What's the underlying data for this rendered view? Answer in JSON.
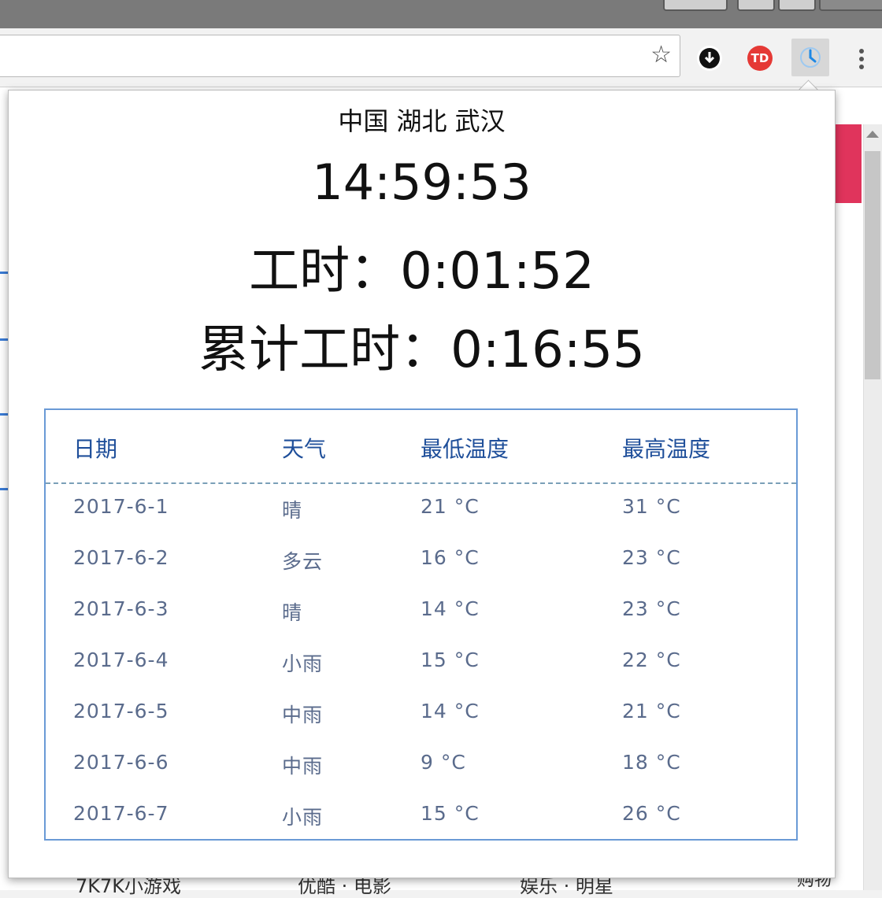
{
  "popup": {
    "location": "中国 湖北 武汉",
    "clock": "14:59:53",
    "work_time": "工时：0:01:52",
    "total_work_time": "累计工时：0:16:55"
  },
  "forecast": {
    "headers": [
      "日期",
      "天气",
      "最低温度",
      "最高温度"
    ],
    "rows": [
      {
        "date": "2017-6-1",
        "weather": "晴",
        "low": "21 °C",
        "high": "31 °C"
      },
      {
        "date": "2017-6-2",
        "weather": "多云",
        "low": "16 °C",
        "high": "23 °C"
      },
      {
        "date": "2017-6-3",
        "weather": "晴",
        "low": "14 °C",
        "high": "23 °C"
      },
      {
        "date": "2017-6-4",
        "weather": "小雨",
        "low": "15 °C",
        "high": "22 °C"
      },
      {
        "date": "2017-6-5",
        "weather": "中雨",
        "low": "14 °C",
        "high": "21 °C"
      },
      {
        "date": "2017-6-6",
        "weather": "中雨",
        "low": "9 °C",
        "high": "18 °C"
      },
      {
        "date": "2017-6-7",
        "weather": "小雨",
        "low": "15 °C",
        "high": "26 °C"
      }
    ]
  },
  "toolbar": {
    "extensions": [
      {
        "icon": "download-extension-icon",
        "color": "#111111"
      },
      {
        "icon": "td-extension-icon",
        "label": "TD",
        "color": "#e53935"
      },
      {
        "icon": "clock-extension-icon",
        "color": "#1e88e5"
      }
    ]
  },
  "background_page": {
    "links": [
      "7K7K小游戏",
      "优酷 · 电影",
      "娱乐 · 明星",
      "购物"
    ]
  }
}
